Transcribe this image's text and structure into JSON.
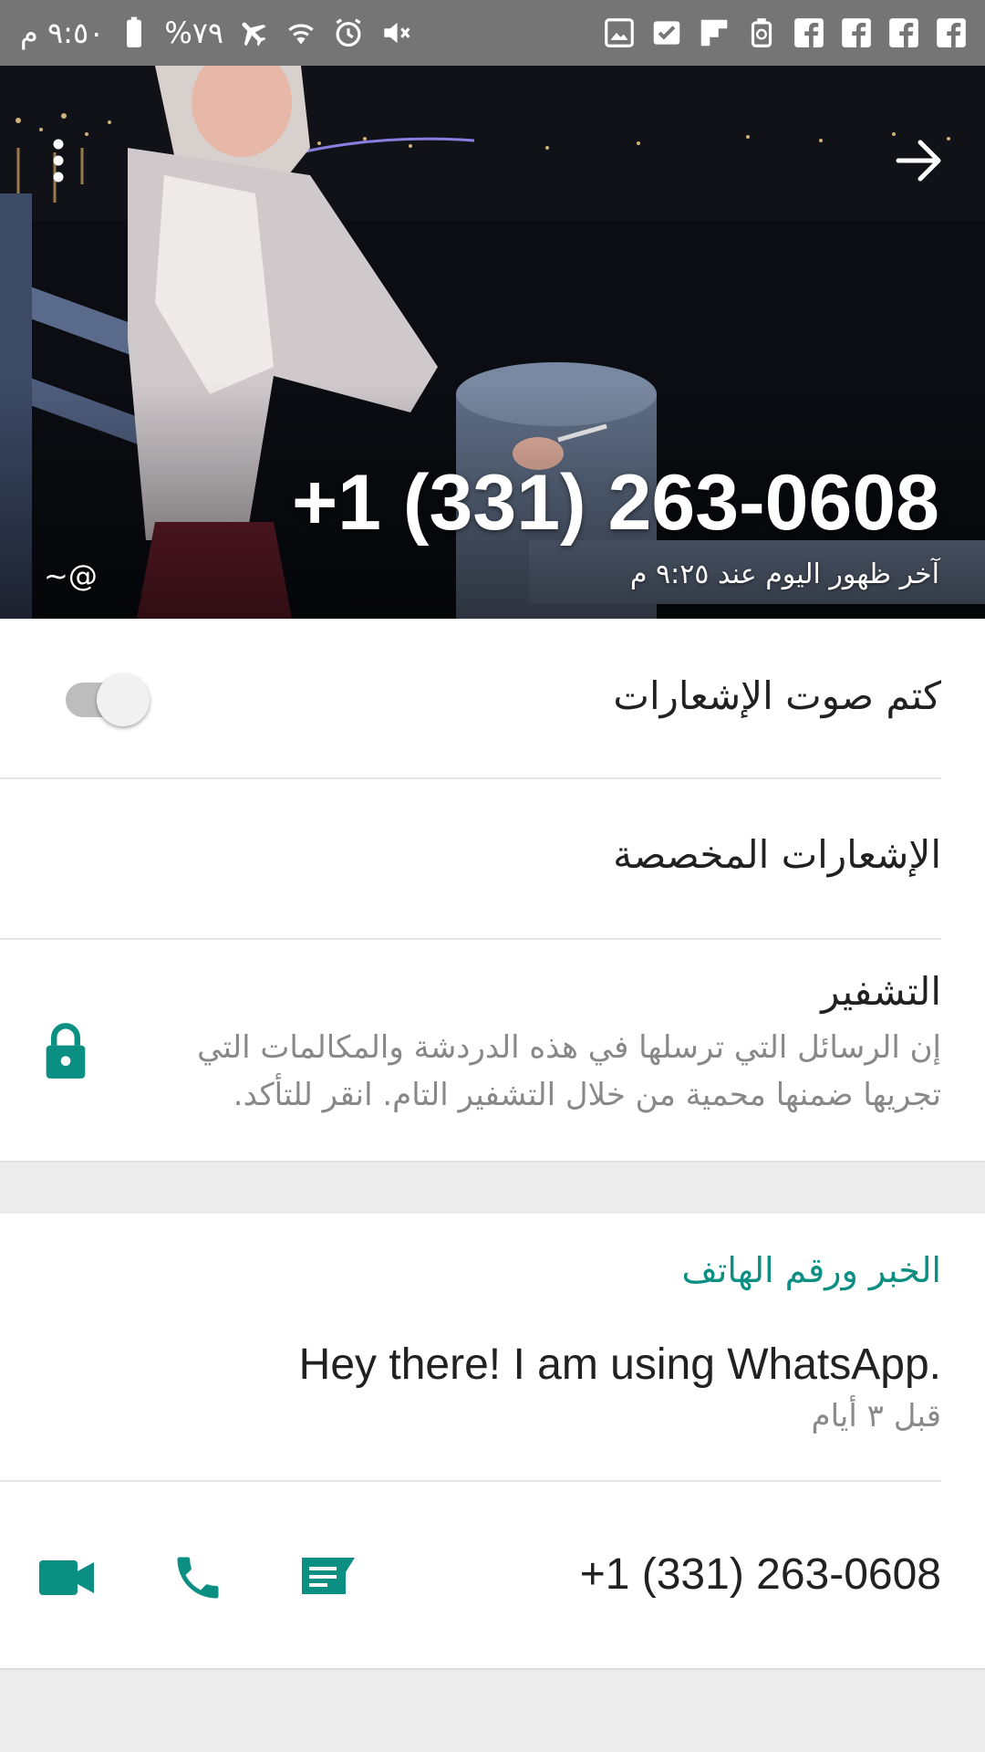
{
  "status_bar": {
    "time": "٩:٥٠ م",
    "battery": "%٧٩",
    "icons_left": [
      "battery-icon",
      "airplane-icon",
      "wifi-icon",
      "alarm-icon",
      "mute-icon"
    ],
    "icons_right": [
      "gallery-icon",
      "checkbox-icon",
      "flipboard-icon",
      "recycle-icon",
      "facebook-icon",
      "facebook-icon",
      "facebook-icon",
      "facebook-icon"
    ]
  },
  "header": {
    "contact_name": "+1 (331) 263-0608",
    "last_seen": "آخر ظهور اليوم عند ٩:٢٥ م",
    "username": "~@"
  },
  "settings": {
    "mute_notifications": "كتم صوت الإشعارات",
    "custom_notifications": "الإشعارات المخصصة",
    "encryption_title": "التشفير",
    "encryption_description": "إن الرسائل التي ترسلها في هذه الدردشة والمكالمات التي تجريها ضمنها محمية من خلال التشفير التام. انقر للتأكد."
  },
  "about": {
    "header": "الخبر ورقم الهاتف",
    "status_text": "Hey there! I am using WhatsApp.",
    "status_time": "قبل ٣ أيام",
    "phone_number": "+1 (331) 263-0608"
  },
  "colors": {
    "accent": "#0a8f82",
    "status_bar": "#757575"
  }
}
